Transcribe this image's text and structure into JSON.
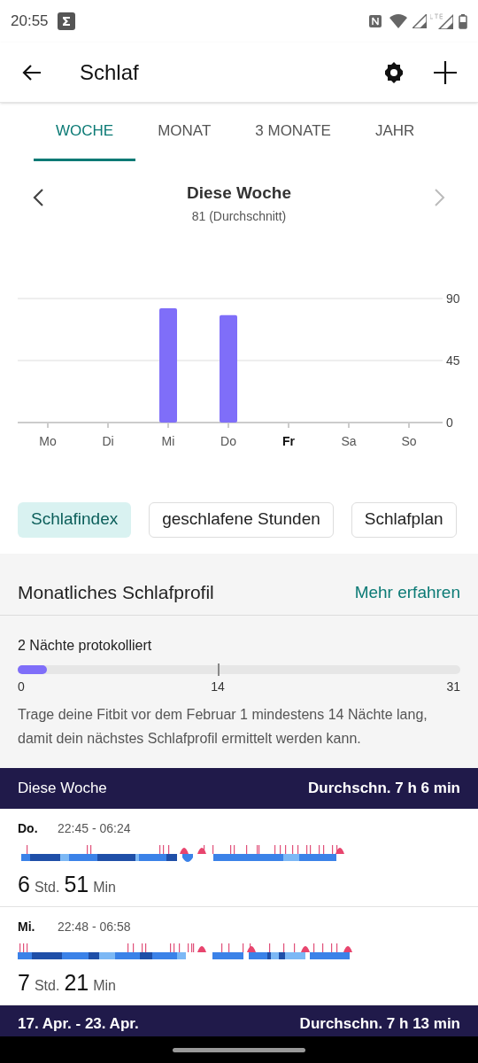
{
  "status_bar": {
    "time": "20:55"
  },
  "app_bar": {
    "title": "Schlaf"
  },
  "tabs": [
    {
      "label": "WOCHE",
      "selected": true
    },
    {
      "label": "MONAT",
      "selected": false
    },
    {
      "label": "3 MONATE",
      "selected": false
    },
    {
      "label": "JAHR",
      "selected": false
    }
  ],
  "period": {
    "title": "Diese Woche",
    "subtitle": "81 (Durchschnitt)"
  },
  "chart_data": {
    "type": "bar",
    "categories": [
      "Mo",
      "Di",
      "Mi",
      "Do",
      "Fr",
      "Sa",
      "So"
    ],
    "values": [
      null,
      null,
      83,
      78,
      null,
      null,
      null
    ],
    "ylim": [
      0,
      90
    ],
    "yticks": [
      0,
      45,
      90
    ]
  },
  "days": [
    {
      "current": false
    },
    {
      "current": false
    },
    {
      "current": false
    },
    {
      "current": false
    },
    {
      "current": true
    },
    {
      "current": false
    },
    {
      "current": false
    }
  ],
  "chips": [
    {
      "label": "Schlafindex",
      "selected": true
    },
    {
      "label": "geschlafene Stunden",
      "selected": false
    },
    {
      "label": "Schlafplan",
      "selected": false
    }
  ],
  "profile": {
    "title": "Monatliches Schlafprofil",
    "link": "Mehr erfahren",
    "progress_label": "2 Nächte protokolliert",
    "level": 0.065,
    "scale": [
      "0",
      "14",
      "31"
    ],
    "note": "Trage deine Fitbit vor dem Februar 1 mindestens 14 Nächte lang, damit dein nächstes Schlafprofil ermittelt werden kann."
  },
  "weeks": [
    {
      "label": "Diese Woche",
      "average": "Durchschn. 7 h 6 min",
      "nights": [
        {
          "day": "Do.",
          "time": "22:45 - 06:24",
          "hours": "6",
          "hours_unit": "Std.",
          "minutes": "51",
          "minutes_unit": "Min"
        },
        {
          "day": "Mi.",
          "time": "22:48 - 06:58",
          "hours": "7",
          "hours_unit": "Std.",
          "minutes": "21",
          "minutes_unit": "Min"
        }
      ]
    },
    {
      "label": "17. Apr. - 23. Apr.",
      "average": "Durchschn. 7 h 13 min"
    }
  ]
}
